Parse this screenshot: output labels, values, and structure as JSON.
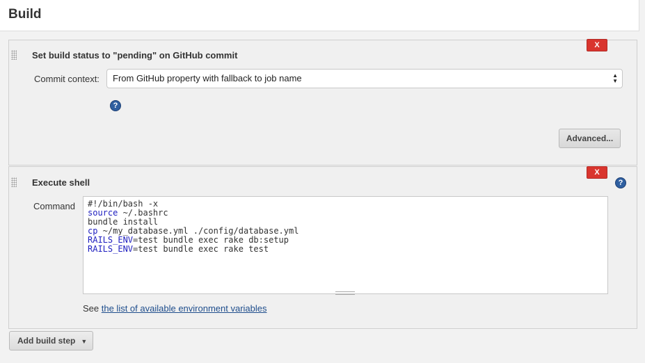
{
  "section": {
    "title": "Build"
  },
  "step1": {
    "title": "Set build status to \"pending\" on GitHub commit",
    "delete_label": "X",
    "context_label": "Commit context:",
    "context_value": "From GitHub property with fallback to job name",
    "help_glyph": "?",
    "advanced_label": "Advanced..."
  },
  "step2": {
    "title": "Execute shell",
    "delete_label": "X",
    "help_glyph": "?",
    "command_label": "Command",
    "command_lines": [
      {
        "kw": "",
        "rest": "#!/bin/bash -x"
      },
      {
        "kw": "source",
        "rest": " ~/.bashrc"
      },
      {
        "kw": "",
        "rest": "bundle install"
      },
      {
        "kw": "cp",
        "rest": " ~/my_database.yml ./config/database.yml"
      },
      {
        "kw": "RAILS_ENV",
        "rest": "=test bundle exec rake db:setup"
      },
      {
        "kw": "RAILS_ENV",
        "rest": "=test bundle exec rake test"
      }
    ],
    "env_prefix": "See ",
    "env_link": "the list of available environment variables"
  },
  "footer": {
    "add_step_label": "Add build step"
  },
  "colors": {
    "delete": "#d9352e",
    "link": "#1e4d8c",
    "keyword": "#2020c0",
    "help": "#2f5fa0"
  }
}
